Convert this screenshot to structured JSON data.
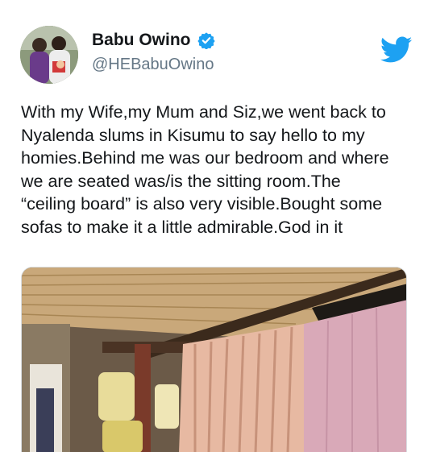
{
  "user": {
    "display_name": "Babu Owino",
    "handle": "@HEBabuOwino",
    "verified": true,
    "avatar_icon": "profile-photo"
  },
  "brand": {
    "icon": "twitter-bird-icon",
    "color": "#1da1f2"
  },
  "tweet": {
    "text": "With my Wife,my Mum and Siz,we went back to\nNyalenda slums in Kisumu to say hello to my\nhomies.Behind me was our bedroom and where\nwe are seated was/is the sitting room.The\n“ceiling board” is also very visible.Bought some\nsofas to make it a little admirable.God in it"
  },
  "media": {
    "icon": "attached-photo"
  }
}
